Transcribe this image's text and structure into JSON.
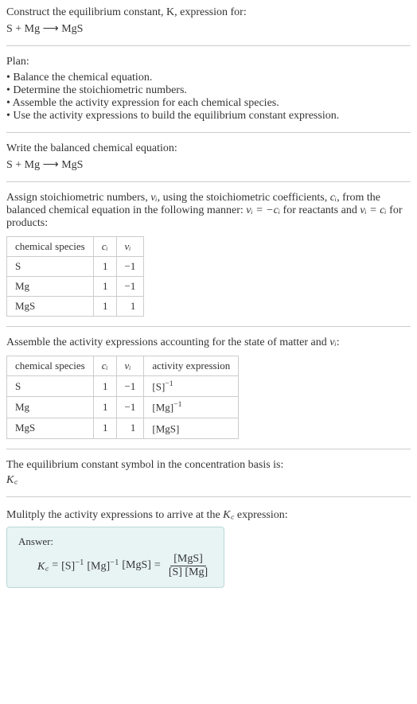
{
  "header": {
    "line1": "Construct the equilibrium constant, K, expression for:",
    "equation": "S + Mg ⟶ MgS"
  },
  "plan": {
    "title": "Plan:",
    "items": [
      "• Balance the chemical equation.",
      "• Determine the stoichiometric numbers.",
      "• Assemble the activity expression for each chemical species.",
      "• Use the activity expressions to build the equilibrium constant expression."
    ]
  },
  "balanced": {
    "text": "Write the balanced chemical equation:",
    "equation": "S + Mg ⟶ MgS"
  },
  "stoich": {
    "text_part1": "Assign stoichiometric numbers, ",
    "nu_i": "νᵢ",
    "text_part2": ", using the stoichiometric coefficients, ",
    "c_i": "cᵢ",
    "text_part3": ", from the balanced chemical equation in the following manner: ",
    "rel1": "νᵢ = −cᵢ",
    "text_part4": " for reactants and ",
    "rel2": "νᵢ = cᵢ",
    "text_part5": " for products:",
    "table": {
      "headers": [
        "chemical species",
        "cᵢ",
        "νᵢ"
      ],
      "rows": [
        [
          "S",
          "1",
          "−1"
        ],
        [
          "Mg",
          "1",
          "−1"
        ],
        [
          "MgS",
          "1",
          "1"
        ]
      ]
    }
  },
  "activity": {
    "text_part1": "Assemble the activity expressions accounting for the state of matter and ",
    "nu_i": "νᵢ",
    "text_part2": ":",
    "table": {
      "headers": [
        "chemical species",
        "cᵢ",
        "νᵢ",
        "activity expression"
      ],
      "rows": [
        {
          "species": "S",
          "c": "1",
          "nu": "−1",
          "expr_base": "[S]",
          "expr_exp": "−1"
        },
        {
          "species": "Mg",
          "c": "1",
          "nu": "−1",
          "expr_base": "[Mg]",
          "expr_exp": "−1"
        },
        {
          "species": "MgS",
          "c": "1",
          "nu": "1",
          "expr_base": "[MgS]",
          "expr_exp": ""
        }
      ]
    }
  },
  "symbol": {
    "text": "The equilibrium constant symbol in the concentration basis is:",
    "kc": "K꜀"
  },
  "multiply": {
    "text_part1": "Mulitply the activity expressions to arrive at the ",
    "kc": "K꜀",
    "text_part2": " expression:"
  },
  "answer": {
    "label": "Answer:",
    "kc": "K꜀",
    "eq": " = ",
    "term1_base": "[S]",
    "term1_exp": "−1",
    "term2_base": "[Mg]",
    "term2_exp": "−1",
    "term3": "[MgS]",
    "frac_num": "[MgS]",
    "frac_den": "[S] [Mg]"
  },
  "chart_data": {
    "type": "table",
    "tables": [
      {
        "title": "Stoichiometric numbers",
        "headers": [
          "chemical species",
          "c_i",
          "nu_i"
        ],
        "rows": [
          [
            "S",
            1,
            -1
          ],
          [
            "Mg",
            1,
            -1
          ],
          [
            "MgS",
            1,
            1
          ]
        ]
      },
      {
        "title": "Activity expressions",
        "headers": [
          "chemical species",
          "c_i",
          "nu_i",
          "activity expression"
        ],
        "rows": [
          [
            "S",
            1,
            -1,
            "[S]^-1"
          ],
          [
            "Mg",
            1,
            -1,
            "[Mg]^-1"
          ],
          [
            "MgS",
            1,
            1,
            "[MgS]"
          ]
        ]
      }
    ]
  }
}
